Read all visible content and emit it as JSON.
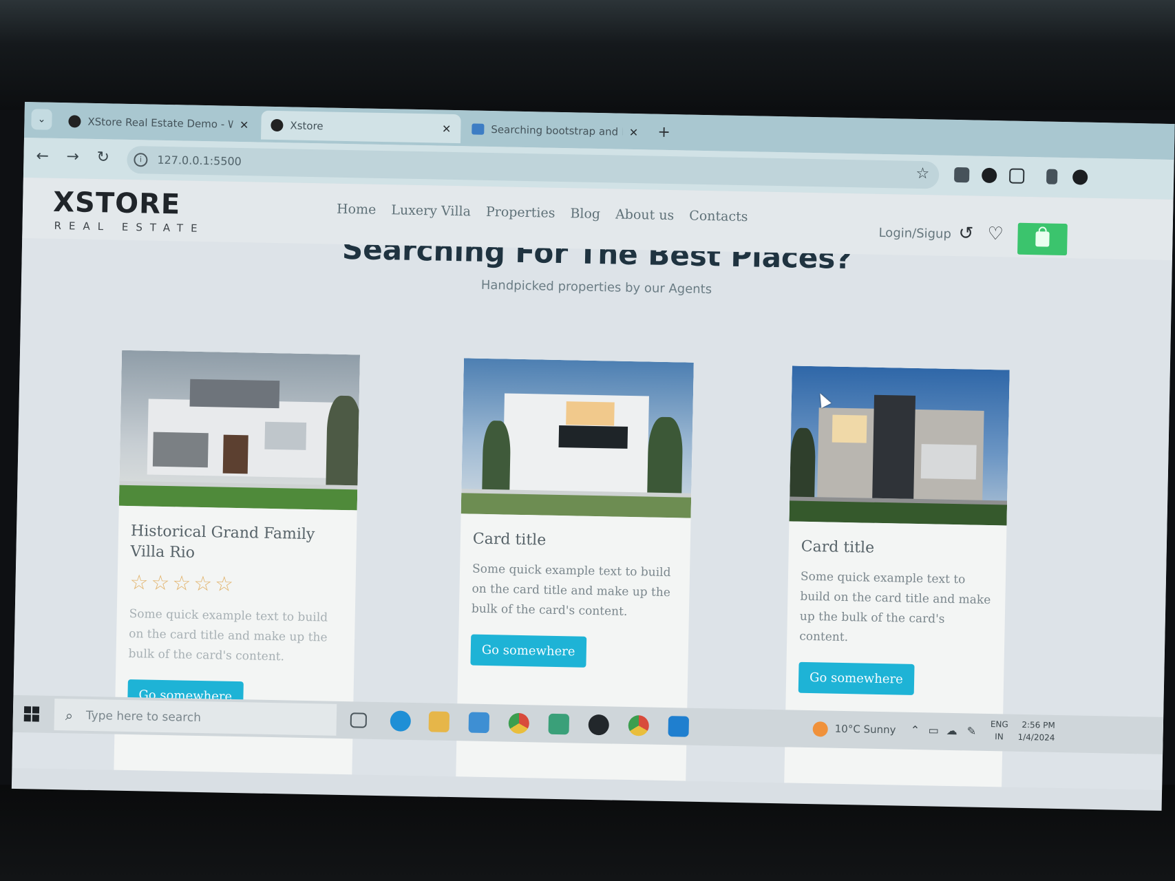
{
  "browser": {
    "tabs": [
      {
        "title": "XStore Real Estate Demo - Wo",
        "active": false
      },
      {
        "title": "Xstore",
        "active": true
      },
      {
        "title": "Searching bootstrap and html c",
        "active": false
      }
    ],
    "url": "127.0.0.1:5500"
  },
  "site": {
    "logo_main": "XSTORE",
    "logo_sub": "REAL ESTATE",
    "nav": [
      "Home",
      "Luxery Villa",
      "Properties",
      "Blog",
      "About us",
      "Contacts"
    ],
    "login_label": "Login/Sigup",
    "hero_title": "Searching For The Best Places?",
    "hero_subtitle": "Handpicked properties by our Agents",
    "accent_color": "#1eb3d6",
    "cart_color": "#3bc46d",
    "cards": [
      {
        "title": "Historical Grand Family Villa Rio",
        "rating": 5,
        "text": "Some quick example text to build on the card title and make up the bulk of the card's content.",
        "button": "Go somewhere"
      },
      {
        "title": "Card title",
        "text": "Some quick example text to build on the card title and make up the bulk of the card's content.",
        "button": "Go somewhere"
      },
      {
        "title": "Card title",
        "text": "Some quick example text to build on the card title and make up the bulk of the card's content.",
        "button": "Go somewhere"
      }
    ]
  },
  "taskbar": {
    "search_placeholder": "Type here to search",
    "weather": "10°C  Sunny",
    "lang_top": "ENG",
    "lang_bottom": "IN",
    "time": "2:56 PM",
    "date": "1/4/2024"
  }
}
